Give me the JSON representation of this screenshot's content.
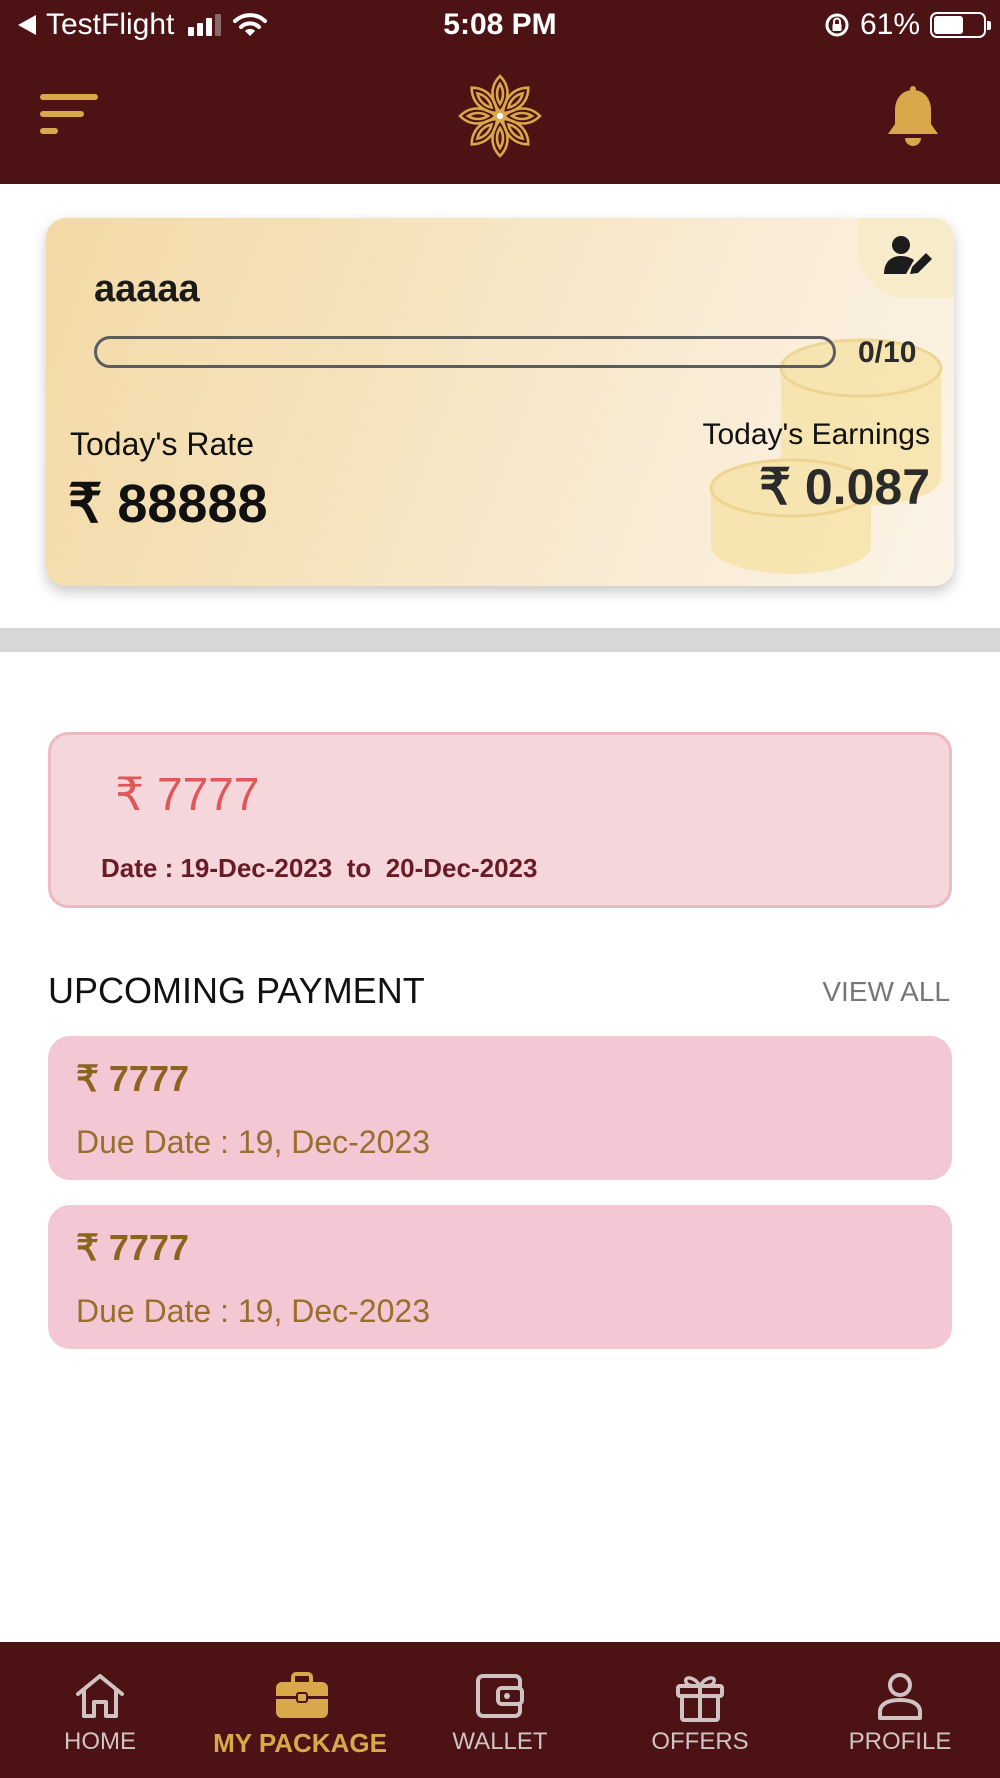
{
  "status_bar": {
    "carrier": "TestFlight",
    "time": "5:08 PM",
    "battery": "61%",
    "battery_level": 0.61
  },
  "header": {
    "menu_icon": "menu-icon",
    "logo_icon": "flower-logo-icon",
    "notification_icon": "bell-icon",
    "brand_color": "#4d1314",
    "accent_color": "#d9a84a"
  },
  "gold_card": {
    "name": "aaaaa",
    "progress_text": "0/10",
    "progress_value": 0,
    "progress_max": 10,
    "rate_label": "Today's Rate",
    "rate_value": "₹ 88888",
    "earnings_label": "Today's Earnings",
    "earnings_value": "₹ 0.087",
    "edit_icon": "user-edit-icon"
  },
  "package": {
    "amount": "₹ 7777",
    "date_label": "Date : ",
    "date_from": "19-Dec-2023",
    "date_sep": "  to  ",
    "date_to": "20-Dec-2023"
  },
  "upcoming": {
    "title": "UPCOMING PAYMENT",
    "view_all": "VIEW ALL",
    "items": [
      {
        "amount": "₹ 7777",
        "due": "Due Date  : 19, Dec-2023"
      },
      {
        "amount": "₹ 7777",
        "due": "Due Date  : 19, Dec-2023"
      }
    ]
  },
  "bottom_nav": {
    "active": "MY PACKAGE",
    "items": [
      {
        "label": "HOME",
        "icon": "home-icon"
      },
      {
        "label": "MY PACKAGE",
        "icon": "briefcase-icon"
      },
      {
        "label": "WALLET",
        "icon": "wallet-icon"
      },
      {
        "label": "OFFERS",
        "icon": "gift-icon"
      },
      {
        "label": "PROFILE",
        "icon": "person-icon"
      }
    ]
  }
}
